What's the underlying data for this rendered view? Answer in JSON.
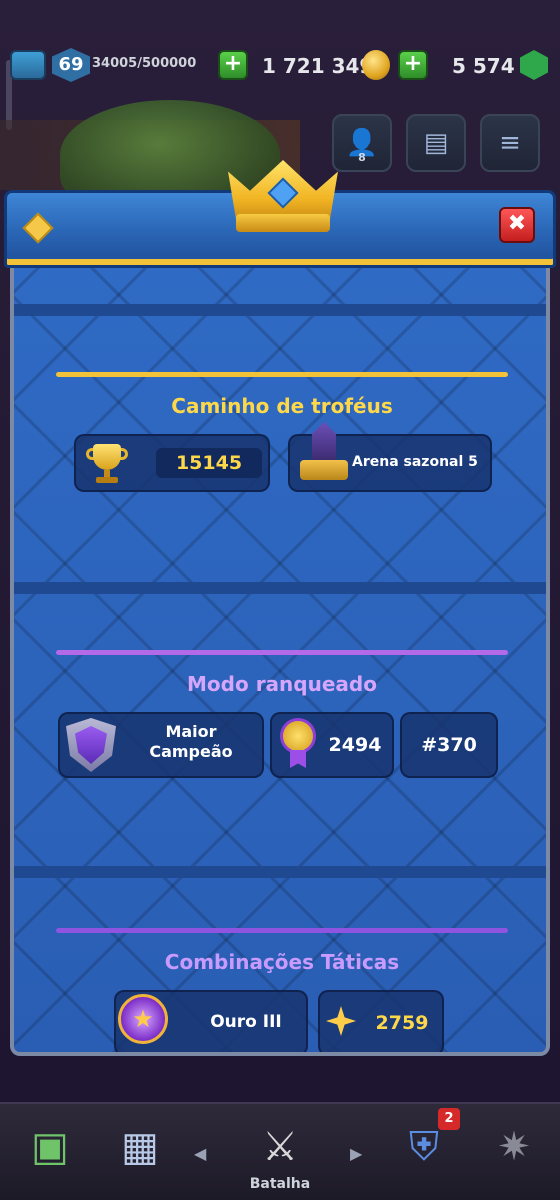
{
  "topbar": {
    "level": "69",
    "xp": "34005/500000",
    "gold": "1 721 349",
    "gems": "5 574",
    "plus_symbol": "+"
  },
  "header_buttons": {
    "friends_count": "8"
  },
  "panel": {
    "close_symbol": "✖"
  },
  "trophy_road": {
    "title": "Caminho de troféus",
    "trophies": "15145",
    "arena": "Arena sazonal 5",
    "accent": "#f2c238"
  },
  "ranked": {
    "title": "Modo ranqueado",
    "league": "Maior\nCampeão",
    "rating": "2494",
    "rank": "#370",
    "accent": "#b26ae8"
  },
  "tactics": {
    "title": "Combinações Táticas",
    "league": "Ouro III",
    "score": "2759",
    "accent": "#8f55e0"
  },
  "nav": {
    "battle_label": "Batalha",
    "clan_badge": "2"
  }
}
